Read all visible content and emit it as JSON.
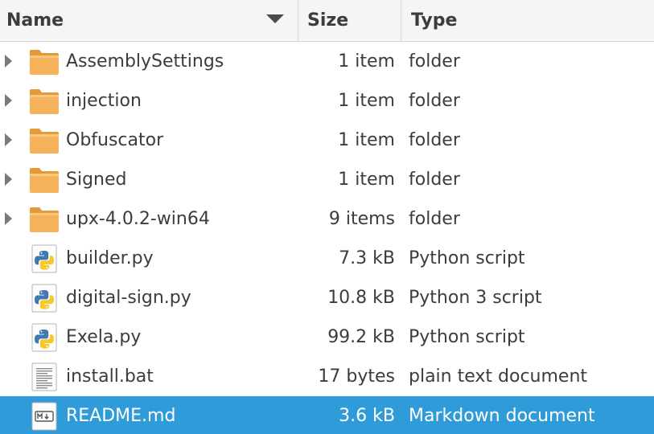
{
  "columns": {
    "name": "Name",
    "size": "Size",
    "type": "Type",
    "sort_indicator_icon": "sort-descending-icon"
  },
  "files": [
    {
      "name": "AssemblySettings",
      "size": "1 item",
      "type": "folder",
      "icon": "folder-icon",
      "expandable": true,
      "selected": false
    },
    {
      "name": "injection",
      "size": "1 item",
      "type": "folder",
      "icon": "folder-icon",
      "expandable": true,
      "selected": false
    },
    {
      "name": "Obfuscator",
      "size": "1 item",
      "type": "folder",
      "icon": "folder-icon",
      "expandable": true,
      "selected": false
    },
    {
      "name": "Signed",
      "size": "1 item",
      "type": "folder",
      "icon": "folder-icon",
      "expandable": true,
      "selected": false
    },
    {
      "name": "upx-4.0.2-win64",
      "size": "9 items",
      "type": "folder",
      "icon": "folder-icon",
      "expandable": true,
      "selected": false
    },
    {
      "name": "builder.py",
      "size": "7.3 kB",
      "type": "Python script",
      "icon": "python-file-icon",
      "expandable": false,
      "selected": false
    },
    {
      "name": "digital-sign.py",
      "size": "10.8 kB",
      "type": "Python 3 script",
      "icon": "python-file-icon",
      "expandable": false,
      "selected": false
    },
    {
      "name": "Exela.py",
      "size": "99.2 kB",
      "type": "Python script",
      "icon": "python-file-icon",
      "expandable": false,
      "selected": false
    },
    {
      "name": "install.bat",
      "size": "17 bytes",
      "type": "plain text document",
      "icon": "text-file-icon",
      "expandable": false,
      "selected": false
    },
    {
      "name": "README.md",
      "size": "3.6 kB",
      "type": "Markdown document",
      "icon": "markdown-file-icon",
      "expandable": false,
      "selected": true
    }
  ],
  "colors": {
    "selection": "#2f9bd8",
    "folder": "#f5b25a",
    "header_bg": "#f5f5f4",
    "text": "#3c3c3c"
  }
}
